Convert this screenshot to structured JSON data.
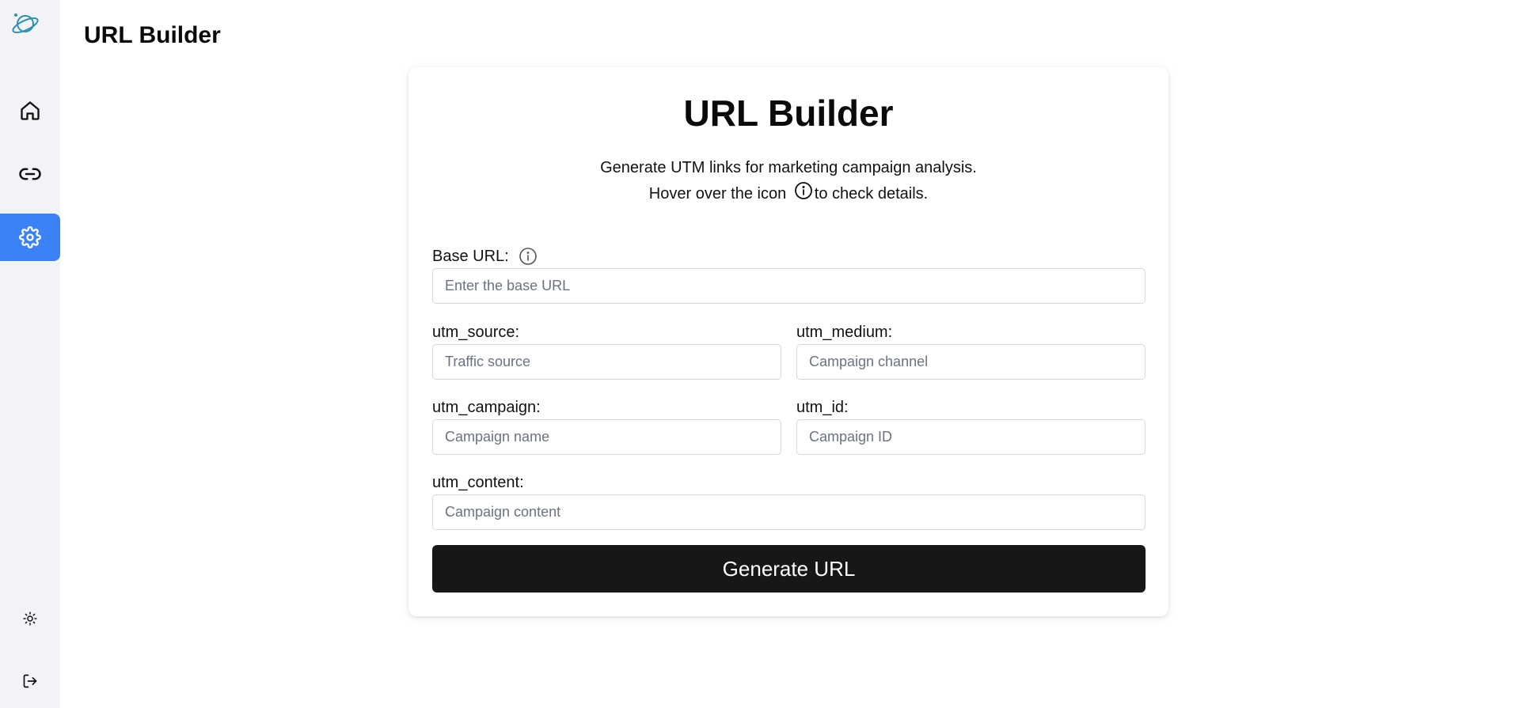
{
  "header": {
    "title": "URL Builder"
  },
  "sidebar": {
    "logo_icon": "planet-logo-icon",
    "items": [
      {
        "name": "home",
        "icon": "home-icon",
        "active": false
      },
      {
        "name": "links",
        "icon": "link-icon",
        "active": false
      },
      {
        "name": "settings",
        "icon": "gear-icon",
        "active": true
      }
    ],
    "bottom": [
      {
        "name": "theme-toggle",
        "icon": "sun-icon"
      },
      {
        "name": "logout",
        "icon": "logout-icon"
      }
    ],
    "accent_color": "#3b82f6"
  },
  "card": {
    "title": "URL Builder",
    "description_line1": "Generate UTM links for marketing campaign analysis.",
    "description_line2_prefix": "Hover over the icon ",
    "description_line2_suffix": "to check details.",
    "info_icon": "info-icon"
  },
  "form": {
    "base_url": {
      "label": "Base URL:",
      "placeholder": "Enter the base URL",
      "value": ""
    },
    "utm_source": {
      "label": "utm_source:",
      "placeholder": "Traffic source",
      "value": ""
    },
    "utm_medium": {
      "label": "utm_medium:",
      "placeholder": "Campaign channel",
      "value": ""
    },
    "utm_campaign": {
      "label": "utm_campaign:",
      "placeholder": "Campaign name",
      "value": ""
    },
    "utm_id": {
      "label": "utm_id:",
      "placeholder": "Campaign ID",
      "value": ""
    },
    "utm_content": {
      "label": "utm_content:",
      "placeholder": "Campaign content",
      "value": ""
    },
    "submit_label": "Generate URL"
  }
}
